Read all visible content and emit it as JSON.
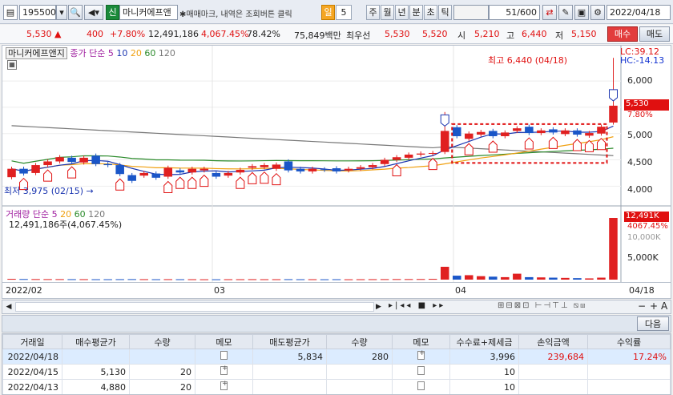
{
  "toolbar": {
    "stock_code": "195500",
    "search_icon": "magnifier-icon",
    "speaker_icon": "speaker-icon",
    "new_badge": "신",
    "stock_name": "마니커에프앤",
    "hint_text": "✱매매마크, 내역은 조회버튼 클릭",
    "periods": [
      "일",
      "5",
      "주",
      "월",
      "년",
      "분",
      "초",
      "틱"
    ],
    "active_period": "일",
    "count_value": "51",
    "count_total": "/600",
    "date": "2022/04/18"
  },
  "quote": {
    "price": "5,530",
    "arrow": "▲",
    "change": "400",
    "change_pct": "+7.80%",
    "volume": "12,491,186",
    "volume_pct": "4,067.45%",
    "ratio": "78.42%",
    "amount": "75,849백만",
    "best_sell_label": "최우선",
    "best_sell": "5,530",
    "best_buy": "5,520",
    "open_label": "시",
    "open": "5,210",
    "high_label": "고",
    "high": "6,440",
    "low_label": "저",
    "low": "5,150",
    "buy_button": "매수",
    "sell_button": "매도"
  },
  "chart": {
    "legend_name": "마니커에프앤지",
    "legend_ma_label": "종가 단순",
    "legend_ma_values": [
      "5",
      "10",
      "20",
      "60",
      "120"
    ],
    "lc_label": "LC:39.12",
    "hc_label": "HC:-14.13",
    "high_annotation": "최고 6,440 (04/18)",
    "low_annotation": "최저 3,975 (02/15)",
    "current_price_tag": "5,530",
    "current_pct_tag": "7.80%",
    "y_ticks": [
      "6,000",
      "5,500",
      "5,000",
      "4,500",
      "4,000"
    ],
    "volume_legend_label": "거래량",
    "volume_legend_ma": "단순",
    "volume_legend_values": [
      "5",
      "20",
      "60",
      "120"
    ],
    "volume_info": "12,491,186주(4,067.45%)",
    "volume_tag": "12,491K",
    "volume_pct_tag": "4067.45%",
    "volume_ticks": [
      "10,000K",
      "5,000K"
    ],
    "x_labels": [
      "2022/02",
      "03",
      "04",
      "04/18"
    ],
    "colors": {
      "up": "#e02020",
      "down": "#1a56c8",
      "ma5": "#1a35b0",
      "ma20": "#f0a010",
      "ma60": "#2a8a2a",
      "ma120": "#777777"
    }
  },
  "chart_data": {
    "type": "candlestick",
    "ylim": [
      3700,
      6550
    ],
    "candles": [
      {
        "o": 4170,
        "c": 4330
      },
      {
        "o": 4330,
        "c": 4240
      },
      {
        "o": 4250,
        "c": 4400
      },
      {
        "o": 4400,
        "c": 4470
      },
      {
        "o": 4470,
        "c": 4550
      },
      {
        "o": 4540,
        "c": 4460
      },
      {
        "o": 4450,
        "c": 4540
      },
      {
        "o": 4580,
        "c": 4420
      },
      {
        "o": 4420,
        "c": 4400
      },
      {
        "o": 4400,
        "c": 4230
      },
      {
        "o": 4210,
        "c": 4100
      },
      {
        "o": 4200,
        "c": 4250
      },
      {
        "o": 4240,
        "c": 4160
      },
      {
        "o": 4180,
        "c": 4350
      },
      {
        "o": 4300,
        "c": 4260
      },
      {
        "o": 4260,
        "c": 4330
      },
      {
        "o": 4300,
        "c": 4330
      },
      {
        "o": 4250,
        "c": 4180
      },
      {
        "o": 4200,
        "c": 4250
      },
      {
        "o": 4260,
        "c": 4310
      },
      {
        "o": 4350,
        "c": 4380
      },
      {
        "o": 4360,
        "c": 4400
      },
      {
        "o": 4330,
        "c": 4410
      },
      {
        "o": 4470,
        "c": 4300
      },
      {
        "o": 4330,
        "c": 4280
      },
      {
        "o": 4280,
        "c": 4330
      },
      {
        "o": 4320,
        "c": 4310
      },
      {
        "o": 4340,
        "c": 4280
      },
      {
        "o": 4300,
        "c": 4330
      },
      {
        "o": 4330,
        "c": 4360
      },
      {
        "o": 4360,
        "c": 4400
      },
      {
        "o": 4420,
        "c": 4500
      },
      {
        "o": 4500,
        "c": 4550
      },
      {
        "o": 4540,
        "c": 4600
      },
      {
        "o": 4600,
        "c": 4620
      },
      {
        "o": 4620,
        "c": 4630
      },
      {
        "o": 4650,
        "c": 5050
      },
      {
        "o": 5120,
        "c": 4950
      },
      {
        "o": 4900,
        "c": 5000
      },
      {
        "o": 4980,
        "c": 5030
      },
      {
        "o": 5050,
        "c": 4950
      },
      {
        "o": 4950,
        "c": 5020
      },
      {
        "o": 5050,
        "c": 5100
      },
      {
        "o": 5130,
        "c": 5010
      },
      {
        "o": 5010,
        "c": 5060
      },
      {
        "o": 5080,
        "c": 5020
      },
      {
        "o": 4990,
        "c": 5060
      },
      {
        "o": 5060,
        "c": 4980
      },
      {
        "o": 4960,
        "c": 5010
      },
      {
        "o": 5000,
        "c": 5130
      },
      {
        "o": 5210,
        "c": 5530
      }
    ],
    "volumes_k": [
      150,
      120,
      110,
      100,
      100,
      90,
      90,
      80,
      80,
      90,
      100,
      90,
      80,
      90,
      80,
      80,
      70,
      70,
      80,
      80,
      90,
      80,
      80,
      90,
      80,
      80,
      70,
      80,
      70,
      80,
      90,
      100,
      110,
      110,
      120,
      150,
      2600,
      800,
      900,
      700,
      600,
      500,
      1200,
      500,
      450,
      400,
      350,
      300,
      250,
      400,
      12491
    ]
  },
  "controls": {
    "next_button": "다음",
    "scroll_left_icon": "arrow-left-icon",
    "scroll_right_icon": "arrow-right-icon",
    "zoom_minus": "−",
    "zoom_plus": "+",
    "font_button": "A"
  },
  "table": {
    "headers": [
      "거래일",
      "매수평균가",
      "수량",
      "메모",
      "매도평균가",
      "수량",
      "메모",
      "수수료+제세금",
      "손익금액",
      "수익률"
    ],
    "rows": [
      {
        "date": "2022/04/18",
        "buy_avg": "",
        "buy_qty": "",
        "buy_memo": "blank",
        "sell_avg": "5,834",
        "sell_qty": "280",
        "sell_memo": "plus",
        "fee": "3,996",
        "pnl": "239,684",
        "ret": "17.24%"
      },
      {
        "date": "2022/04/15",
        "buy_avg": "5,130",
        "buy_qty": "20",
        "buy_memo": "plus",
        "sell_avg": "",
        "sell_qty": "",
        "sell_memo": "blank",
        "fee": "10",
        "pnl": "",
        "ret": ""
      },
      {
        "date": "2022/04/13",
        "buy_avg": "4,880",
        "buy_qty": "20",
        "buy_memo": "plus",
        "sell_avg": "",
        "sell_qty": "",
        "sell_memo": "blank",
        "fee": "10",
        "pnl": "",
        "ret": ""
      }
    ]
  }
}
